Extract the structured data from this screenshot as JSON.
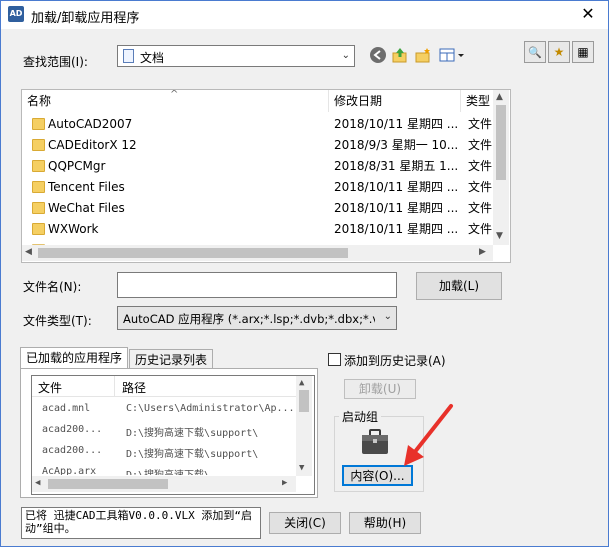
{
  "window": {
    "title": "加载/卸载应用程序",
    "icon_text": "AD",
    "close": "✕"
  },
  "lookin": {
    "label": "查找范围(I):",
    "value": "文档"
  },
  "toolbar_right": {
    "b1": "🔍",
    "b2": "★",
    "b3": "▦"
  },
  "filelist": {
    "headers": {
      "name": "名称",
      "date": "修改日期",
      "type": "类型"
    },
    "rows": [
      {
        "name": "AutoCAD2007",
        "date": "2018/10/11 星期四 ...",
        "type": "文件"
      },
      {
        "name": "CADEditorX 12",
        "date": "2018/9/3 星期一 10...",
        "type": "文件"
      },
      {
        "name": "QQPCMgr",
        "date": "2018/8/31 星期五 1...",
        "type": "文件"
      },
      {
        "name": "Tencent Files",
        "date": "2018/10/11 星期四 ...",
        "type": "文件"
      },
      {
        "name": "WeChat Files",
        "date": "2018/10/11 星期四 ...",
        "type": "文件"
      },
      {
        "name": "WXWork",
        "date": "2018/10/11 星期四 ...",
        "type": "文件"
      }
    ]
  },
  "filename": {
    "label": "文件名(N):",
    "value": "",
    "load_button": "加载(L)"
  },
  "filetype": {
    "label": "文件类型(T):",
    "value": "AutoCAD 应用程序 (*.arx;*.lsp;*.dvb;*.dbx;*.vlx"
  },
  "tabs": {
    "loaded": "已加载的应用程序",
    "history": "历史记录列表"
  },
  "loaded_list": {
    "headers": {
      "file": "文件",
      "path": "路径"
    },
    "rows": [
      {
        "file": "acad.mnl",
        "path": "C:\\Users\\Administrator\\Ap..."
      },
      {
        "file": "acad200...",
        "path": "D:\\搜狗高速下载\\support\\"
      },
      {
        "file": "acad200...",
        "path": "D:\\搜狗高速下载\\support\\"
      },
      {
        "file": "AcApp.arx",
        "path": "D:\\搜狗高速下载\\"
      }
    ]
  },
  "add_history": {
    "label": "添加到历史记录(A)",
    "checked": false
  },
  "unload_button": "卸载(U)",
  "startup": {
    "group_label": "启动组",
    "contents_button": "内容(O)..."
  },
  "status": {
    "text": "已将 迅捷CAD工具箱V0.0.0.VLX 添加到“启动”组中。"
  },
  "close_button": "关闭(C)",
  "help_button": "帮助(H)",
  "colors": {
    "accent": "#0078d7",
    "annotation_arrow": "#e8312a",
    "folder": "#f5cf62"
  }
}
